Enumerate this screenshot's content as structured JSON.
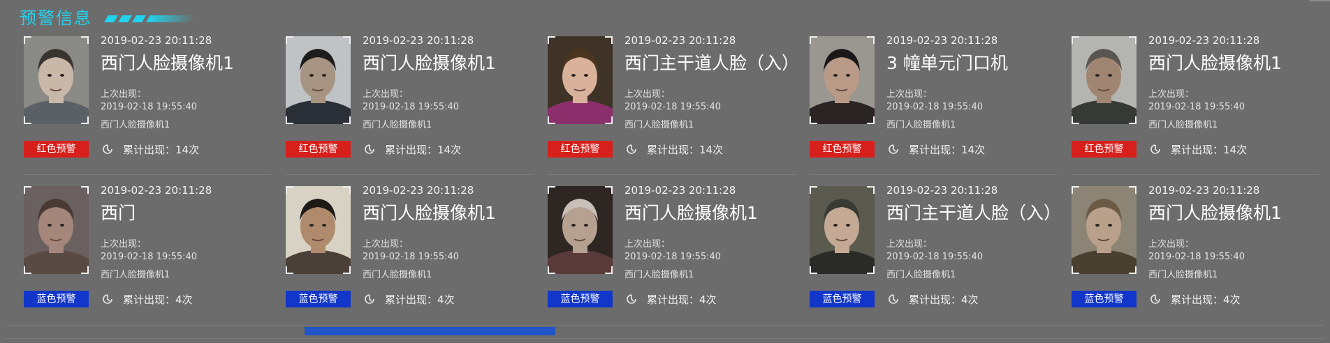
{
  "header": {
    "title": "预警信息"
  },
  "colors": {
    "accent": "#22d3ee",
    "red_badge": "#d7201c",
    "blue_badge": "#1136c9",
    "scroll_thumb": "#1f55c8",
    "background": "#6b6b6b"
  },
  "scrollbar": {
    "position": 0.28,
    "visible_fraction": 0.19
  },
  "cards": [
    {
      "time": "2019-02-23 20:11:28",
      "camera": "西门人脸摄像机1",
      "last_label": "上次出现：",
      "last_time": "2019-02-18 19:55:40",
      "last_camera": "西门人脸摄像机1",
      "badge": "红色预警",
      "badge_type": "red",
      "count": "累计出现：14次",
      "skin": "#c9b8a8",
      "hair": "#3a3430",
      "cloth": "#5a6066",
      "bg": "#8a8a86"
    },
    {
      "time": "2019-02-23 20:11:28",
      "camera": "西门人脸摄像机1",
      "last_label": "上次出现：",
      "last_time": "2019-02-18 19:55:40",
      "last_camera": "西门人脸摄像机1",
      "badge": "红色预警",
      "badge_type": "red",
      "count": "累计出现：14次",
      "skin": "#a89482",
      "hair": "#1e1c1a",
      "cloth": "#2b2f38",
      "bg": "#bfc3c6"
    },
    {
      "time": "2019-02-23 20:11:28",
      "camera": "西门主干道人脸（入）",
      "last_label": "上次出现：",
      "last_time": "2019-02-18 19:55:40",
      "last_camera": "西门人脸摄像机1",
      "badge": "红色预警",
      "badge_type": "red",
      "count": "累计出现：14次",
      "skin": "#d8b29a",
      "hair": "#4a3520",
      "cloth": "#8c2f6d",
      "bg": "#3e3326"
    },
    {
      "time": "2019-02-23 20:11:28",
      "camera": "3 幢单元门口机",
      "last_label": "上次出现：",
      "last_time": "2019-02-18 19:55:40",
      "last_camera": "西门人脸摄像机1",
      "badge": "红色预警",
      "badge_type": "red",
      "count": "累计出现：14次",
      "skin": "#b89a86",
      "hair": "#1a1818",
      "cloth": "#2a2424",
      "bg": "#9a9690"
    },
    {
      "time": "2019-02-23 20:11:28",
      "camera": "西门人脸摄像机1",
      "last_label": "上次出现：",
      "last_time": "2019-02-18 19:55:40",
      "last_camera": "西门人脸摄像机1",
      "badge": "红色预警",
      "badge_type": "red",
      "count": "累计出现：14次",
      "skin": "#a08672",
      "hair": "#5a5550",
      "cloth": "#363a36",
      "bg": "#b4b4b0"
    },
    {
      "time": "2019-02-23 20:11:28",
      "camera": "西门",
      "last_label": "上次出现：",
      "last_time": "2019-02-18 19:55:40",
      "last_camera": "西门人脸摄像机1",
      "badge": "蓝色预警",
      "badge_type": "blue",
      "count": "累计出现：4次",
      "skin": "#a4877a",
      "hair": "#4a3a34",
      "cloth": "#5a4a44",
      "bg": "#6a6060"
    },
    {
      "time": "2019-02-23 20:11:28",
      "camera": "西门人脸摄像机1",
      "last_label": "上次出现：",
      "last_time": "2019-02-18 19:55:40",
      "last_camera": "西门人脸摄像机1",
      "badge": "蓝色预警",
      "badge_type": "blue",
      "count": "累计出现：4次",
      "skin": "#b08a6c",
      "hair": "#1e1a16",
      "cloth": "#4a4038",
      "bg": "#d8d2c4"
    },
    {
      "time": "2019-02-23 20:11:28",
      "camera": "西门人脸摄像机1",
      "last_label": "上次出现：",
      "last_time": "2019-02-18 19:55:40",
      "last_camera": "西门人脸摄像机1",
      "badge": "蓝色预警",
      "badge_type": "blue",
      "count": "累计出现：4次",
      "skin": "#b6a090",
      "hair": "#c8c0b8",
      "cloth": "#5a3a3a",
      "bg": "#2e2622"
    },
    {
      "time": "2019-02-23 20:11:28",
      "camera": "西门主干道人脸（入）",
      "last_label": "上次出现：",
      "last_time": "2019-02-18 19:55:40",
      "last_camera": "西门人脸摄像机1",
      "badge": "蓝色预警",
      "badge_type": "blue",
      "count": "累计出现：4次",
      "skin": "#c4aa94",
      "hair": "#3a3a34",
      "cloth": "#2a2a26",
      "bg": "#5a5a4e"
    },
    {
      "time": "2019-02-23 20:11:28",
      "camera": "西门人脸摄像机1",
      "last_label": "上次出现：",
      "last_time": "2019-02-18 19:55:40",
      "last_camera": "西门人脸摄像机1",
      "badge": "蓝色预警",
      "badge_type": "blue",
      "count": "累计出现：4次",
      "skin": "#b8a08a",
      "hair": "#6a5a46",
      "cloth": "#4a4030",
      "bg": "#8c8474"
    }
  ]
}
